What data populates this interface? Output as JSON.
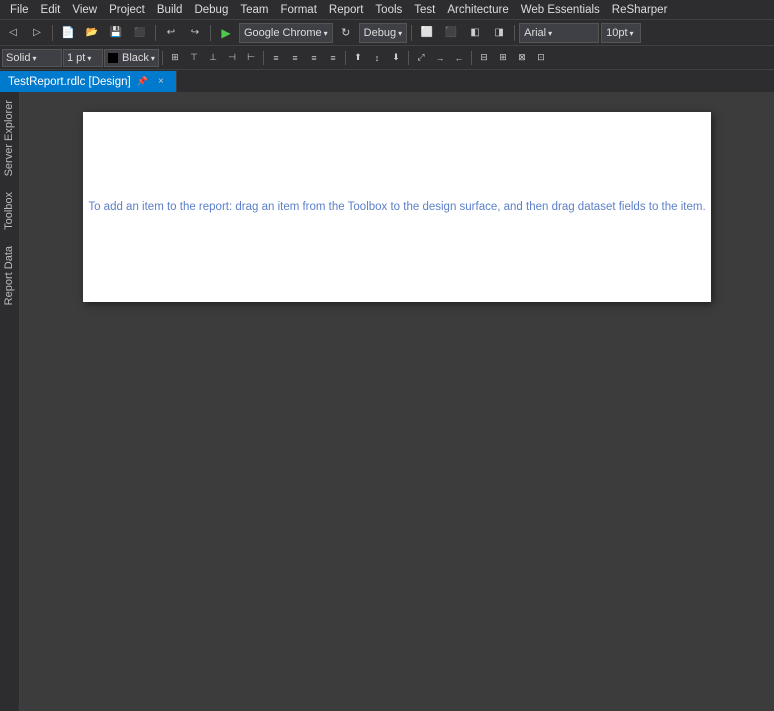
{
  "menubar": {
    "items": [
      {
        "label": "File"
      },
      {
        "label": "Edit"
      },
      {
        "label": "View"
      },
      {
        "label": "Project"
      },
      {
        "label": "Build"
      },
      {
        "label": "Debug"
      },
      {
        "label": "Team"
      },
      {
        "label": "Format"
      },
      {
        "label": "Report"
      },
      {
        "label": "Tools"
      },
      {
        "label": "Test"
      },
      {
        "label": "Architecture"
      },
      {
        "label": "Web Essentials"
      },
      {
        "label": "ReSharper"
      }
    ]
  },
  "toolbar": {
    "play_label": "▶",
    "browser_label": "Google Chrome",
    "config_label": "Debug",
    "font_label": "Arial",
    "size_label": "10pt",
    "back_icon": "◁",
    "forward_icon": "▷",
    "save_icons": "💾",
    "undo_icon": "↩",
    "redo_icon": "↪"
  },
  "format_toolbar": {
    "border_style": "Solid",
    "border_width": "1 pt",
    "border_color": "Black"
  },
  "tab": {
    "title": "TestReport.rdlc [Design]",
    "close_icon": "×",
    "pin_icon": "📌"
  },
  "sidebar": {
    "items": [
      {
        "label": "Server Explorer"
      },
      {
        "label": "Toolbox"
      },
      {
        "label": "Report Data"
      }
    ]
  },
  "canvas": {
    "hint_text": "To add an item to the report: drag an item from the Toolbox to the design surface, and then drag dataset fields to the item."
  }
}
